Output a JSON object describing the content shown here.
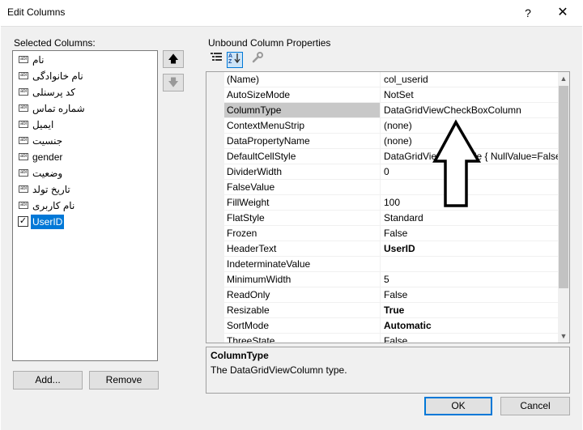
{
  "window": {
    "title": "Edit Columns",
    "help_label": "?",
    "close_label": "✕"
  },
  "selected_columns": {
    "label": "Selected Columns:",
    "items": [
      {
        "text": "نام",
        "icon": "abl"
      },
      {
        "text": "نام خانوادگی",
        "icon": "abl"
      },
      {
        "text": "کد پرسنلی",
        "icon": "abl"
      },
      {
        "text": "شماره تماس",
        "icon": "abl"
      },
      {
        "text": "ایمیل",
        "icon": "abl"
      },
      {
        "text": "جنسیت",
        "icon": "abl"
      },
      {
        "text": "gender",
        "icon": "abl"
      },
      {
        "text": "وضعیت",
        "icon": "abl"
      },
      {
        "text": "تاریخ تولد",
        "icon": "abl"
      },
      {
        "text": "نام کاربری",
        "icon": "abl"
      },
      {
        "text": "UserID",
        "icon": "checkbox",
        "checked": "✓",
        "selected": true
      }
    ],
    "move_up_label": "🡅",
    "move_down_label": "🡇"
  },
  "buttons": {
    "add": "Add...",
    "remove": "Remove",
    "ok": "OK",
    "cancel": "Cancel"
  },
  "properties": {
    "label": "Unbound Column Properties",
    "toolbar": {
      "categorized_icon": "categorized-icon",
      "alphabetical_icon": "alphabetical-icon",
      "property_pages_icon": "wrench-icon"
    },
    "rows": [
      {
        "name": "(Name)",
        "value": "col_userid"
      },
      {
        "name": "AutoSizeMode",
        "value": "NotSet"
      },
      {
        "name": "ColumnType",
        "value": "DataGridViewCheckBoxColumn",
        "selected": true
      },
      {
        "name": "ContextMenuStrip",
        "value": "(none)"
      },
      {
        "name": "DataPropertyName",
        "value": "(none)"
      },
      {
        "name": "DefaultCellStyle",
        "value": "DataGridViewCellStyle { NullValue=False,"
      },
      {
        "name": "DividerWidth",
        "value": "0"
      },
      {
        "name": "FalseValue",
        "value": ""
      },
      {
        "name": "FillWeight",
        "value": "100"
      },
      {
        "name": "FlatStyle",
        "value": "Standard"
      },
      {
        "name": "Frozen",
        "value": "False"
      },
      {
        "name": "HeaderText",
        "value": "UserID",
        "bold": true
      },
      {
        "name": "IndeterminateValue",
        "value": ""
      },
      {
        "name": "MinimumWidth",
        "value": "5"
      },
      {
        "name": "ReadOnly",
        "value": "False"
      },
      {
        "name": "Resizable",
        "value": "True",
        "bold": true
      },
      {
        "name": "SortMode",
        "value": "Automatic",
        "bold": true
      },
      {
        "name": "ThreeState",
        "value": "False"
      }
    ]
  },
  "description": {
    "title": "ColumnType",
    "text": "The DataGridViewColumn type."
  },
  "colors": {
    "accent": "#0078d7",
    "selected_row": "#c8c8c8"
  }
}
